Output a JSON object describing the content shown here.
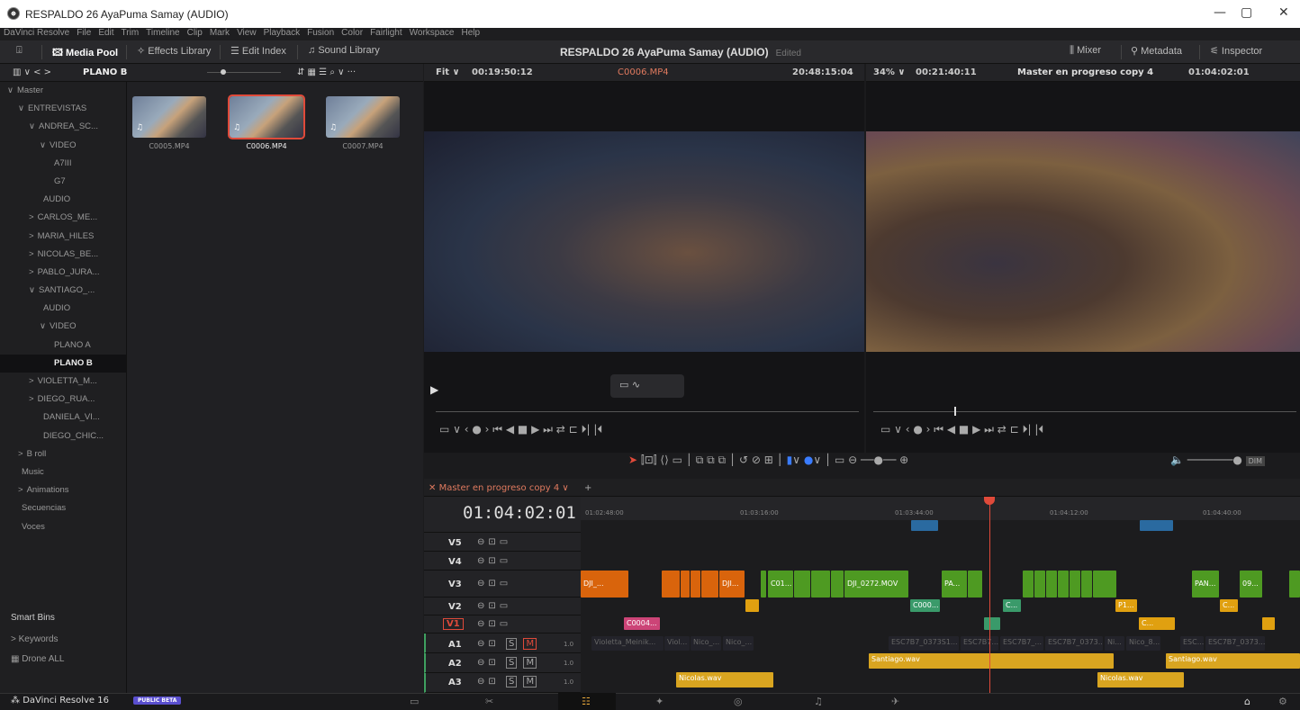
{
  "window": {
    "title": "RESPALDO 26 AyaPuma Samay (AUDIO)",
    "minimize": "—",
    "maximize": "▢",
    "close": "✕"
  },
  "menu": [
    "DaVinci Resolve",
    "File",
    "Edit",
    "Trim",
    "Timeline",
    "Clip",
    "Mark",
    "View",
    "Playback",
    "Fusion",
    "Color",
    "Fairlight",
    "Workspace",
    "Help"
  ],
  "toolbar": {
    "media_pool": "Media Pool",
    "effects": "Effects Library",
    "edit_index": "Edit Index",
    "sound": "Sound Library",
    "project": "RESPALDO 26 AyaPuma Samay (AUDIO)",
    "edited": "Edited",
    "mixer": "Mixer",
    "metadata": "Metadata",
    "inspector": "Inspector"
  },
  "pool_header": {
    "bin": "PLANO B"
  },
  "source_header": {
    "fit": "Fit",
    "tc1": "00:19:50:12",
    "clip": "C0006.MP4",
    "tc2": "20:48:15:04"
  },
  "timeline_header": {
    "zoom": "34%",
    "tc1": "00:21:40:11",
    "name": "Master en progreso copy 4",
    "tc2": "01:04:02:01"
  },
  "tree": [
    {
      "label": "Master",
      "indent": 0,
      "prefix": "∨"
    },
    {
      "label": "ENTREVISTAS",
      "indent": 1,
      "prefix": "∨"
    },
    {
      "label": "ANDREA_SC...",
      "indent": 2,
      "prefix": "∨"
    },
    {
      "label": "VIDEO",
      "indent": 3,
      "prefix": "∨"
    },
    {
      "label": "A7III",
      "indent": 4,
      "prefix": ""
    },
    {
      "label": "G7",
      "indent": 4,
      "prefix": ""
    },
    {
      "label": "AUDIO",
      "indent": 3,
      "prefix": ""
    },
    {
      "label": "CARLOS_ME...",
      "indent": 2,
      "prefix": ">"
    },
    {
      "label": "MARIA_HILES",
      "indent": 2,
      "prefix": ">"
    },
    {
      "label": "NICOLAS_BE...",
      "indent": 2,
      "prefix": ">"
    },
    {
      "label": "PABLO_JURA...",
      "indent": 2,
      "prefix": ">"
    },
    {
      "label": "SANTIAGO_...",
      "indent": 2,
      "prefix": "∨"
    },
    {
      "label": "AUDIO",
      "indent": 3,
      "prefix": ""
    },
    {
      "label": "VIDEO",
      "indent": 3,
      "prefix": "∨"
    },
    {
      "label": "PLANO A",
      "indent": 4,
      "prefix": ""
    },
    {
      "label": "PLANO B",
      "indent": 4,
      "prefix": "",
      "sel": true
    },
    {
      "label": "VIOLETTA_M...",
      "indent": 2,
      "prefix": ">"
    },
    {
      "label": "DIEGO_RUA...",
      "indent": 2,
      "prefix": ">"
    },
    {
      "label": "DANIELA_VI...",
      "indent": 3,
      "prefix": ""
    },
    {
      "label": "DIEGO_CHIC...",
      "indent": 3,
      "prefix": ""
    },
    {
      "label": "B roll",
      "indent": 1,
      "prefix": ">"
    },
    {
      "label": "Music",
      "indent": 1,
      "prefix": ""
    },
    {
      "label": "Animations",
      "indent": 1,
      "prefix": ">"
    },
    {
      "label": "Secuencias",
      "indent": 1,
      "prefix": ""
    },
    {
      "label": "Voces",
      "indent": 1,
      "prefix": ""
    }
  ],
  "smart_bins": {
    "title": "Smart Bins",
    "keywords": "Keywords",
    "drone": "Drone ALL"
  },
  "clips": [
    {
      "name": "C0005.MP4"
    },
    {
      "name": "C0006.MP4"
    },
    {
      "name": "C0007.MP4"
    }
  ],
  "timeline": {
    "tab": "Master en progreso copy 4",
    "timecode": "01:04:02:01",
    "ruler": [
      "01:02:48:00",
      "01:03:16:00",
      "01:03:44:00",
      "01:04:12:00",
      "01:04:40:00"
    ],
    "video_tracks": [
      "V5",
      "V4",
      "V3",
      "V2",
      "V1"
    ],
    "audio_tracks": [
      {
        "name": "A1",
        "vol": "1.0"
      },
      {
        "name": "A2",
        "vol": "1.0"
      },
      {
        "name": "A3",
        "vol": "1.0"
      }
    ],
    "v3_labels": [
      "DJI_...",
      "DJI...",
      "C01...",
      "DJI_0272.MOV",
      "PA...",
      "PAN...",
      "09..."
    ],
    "v2_labels": [
      "C000...",
      "C...",
      "P1...",
      "C..."
    ],
    "v1_labels": [
      "C0004...",
      "C..."
    ],
    "a1_labels": [
      "Violetta_Meinik...",
      "Viol...",
      "Nico_...",
      "Nico_...",
      "ESC7B7_0373S1...",
      "ESC7B7...",
      "ESC7B7_...",
      "ESC7B7_0373...",
      "Ni...",
      "Nico_8...",
      "ESC...",
      "ESC7B7_0373..."
    ],
    "a2_labels": [
      "Santiago.wav",
      "Santiago.wav"
    ],
    "a3_labels": [
      "Nicolas.wav",
      "Nicolas.wav"
    ]
  },
  "status": {
    "app": "DaVinci Resolve 16",
    "beta": "PUBLIC BETA"
  }
}
